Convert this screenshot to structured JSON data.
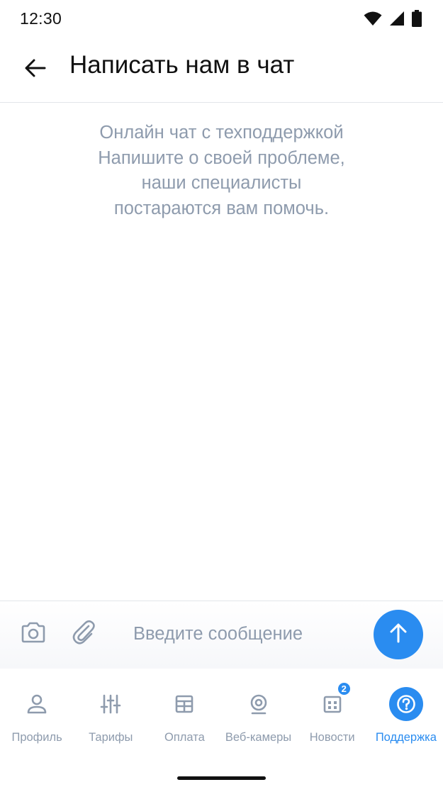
{
  "status_bar": {
    "time": "12:30",
    "icons": [
      "wifi-icon",
      "signal-icon",
      "battery-icon"
    ]
  },
  "header": {
    "back_icon": "arrow-left-icon",
    "title": "Написать нам в чат"
  },
  "chat": {
    "empty_lines": [
      "Онлайн чат с техподдержкой",
      "Напишите о своей проблеме,",
      "наши специалисты",
      "постараются вам помочь."
    ]
  },
  "composer": {
    "camera_icon": "camera-icon",
    "attach_icon": "paperclip-icon",
    "value": "",
    "placeholder": "Введите сообщение",
    "send_icon": "arrow-up-icon"
  },
  "bottom_nav": {
    "items": [
      {
        "label": "Профиль",
        "icon": "profile-icon"
      },
      {
        "label": "Тарифы",
        "icon": "sliders-icon"
      },
      {
        "label": "Оплата",
        "icon": "payment-icon"
      },
      {
        "label": "Веб-камеры",
        "icon": "webcam-icon"
      },
      {
        "label": "Новости",
        "icon": "news-icon",
        "badge": "2"
      },
      {
        "label": "Поддержка",
        "icon": "help-icon",
        "active": true
      }
    ]
  },
  "colors": {
    "accent": "#2a8cf0",
    "muted_text": "#8e9bad",
    "icon_gray": "#8e9bad"
  }
}
